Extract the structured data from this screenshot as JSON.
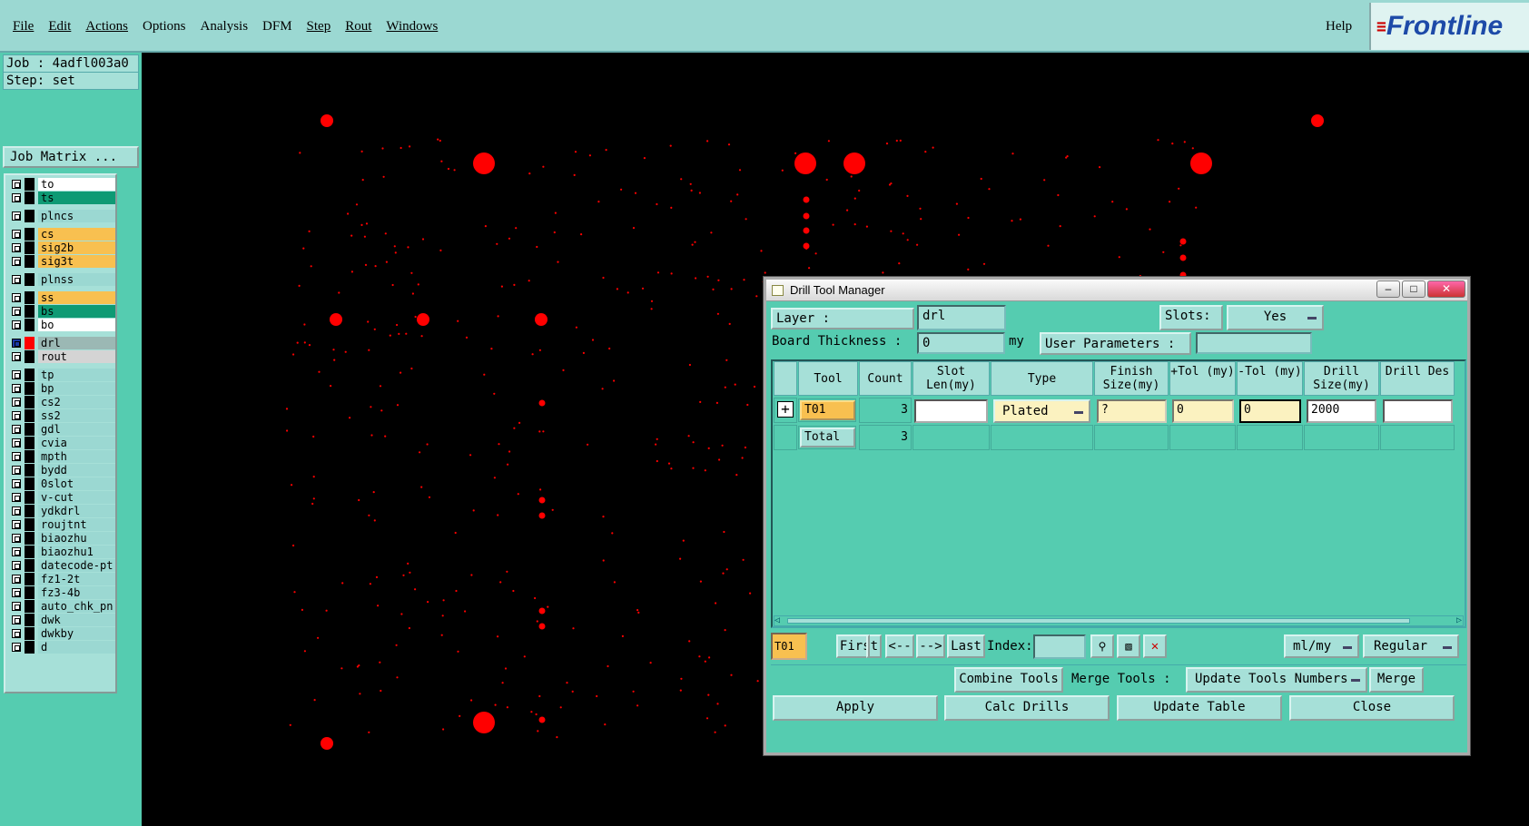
{
  "menubar": {
    "items": [
      "File",
      "Edit",
      "Actions",
      "Options",
      "Analysis",
      "DFM",
      "Step",
      "Rout",
      "Windows"
    ],
    "help": "Help",
    "logo": "Frontline"
  },
  "sidebar": {
    "job": "Job : 4adfl003a0",
    "step": "Step: set",
    "job_matrix": "Job Matrix ...",
    "layers": [
      {
        "name": "to",
        "color": "#ffffff"
      },
      {
        "name": "ts",
        "color": "#0e9a74"
      },
      {
        "name": "plncs",
        "color": "#9bd8d2"
      },
      {
        "name": "cs",
        "color": "#f8c050"
      },
      {
        "name": "sig2b",
        "color": "#f8c050"
      },
      {
        "name": "sig3t",
        "color": "#f8c050"
      },
      {
        "name": "plnss",
        "color": "#9bd8d2"
      },
      {
        "name": "ss",
        "color": "#f8c050"
      },
      {
        "name": "bs",
        "color": "#0e9a74"
      },
      {
        "name": "bo",
        "color": "#ffffff"
      },
      {
        "name": "drl",
        "color": "#9bb8b4"
      },
      {
        "name": "rout",
        "color": "#d4d4d4"
      },
      {
        "name": "tp",
        "color": "#9bd8d2"
      },
      {
        "name": "bp",
        "color": "#9bd8d2"
      },
      {
        "name": "cs2",
        "color": "#9bd8d2"
      },
      {
        "name": "ss2",
        "color": "#9bd8d2"
      },
      {
        "name": "gdl",
        "color": "#9bd8d2"
      },
      {
        "name": "cvia",
        "color": "#9bd8d2"
      },
      {
        "name": "mpth",
        "color": "#9bd8d2"
      },
      {
        "name": "bydd",
        "color": "#9bd8d2"
      },
      {
        "name": "0slot",
        "color": "#9bd8d2"
      },
      {
        "name": "v-cut",
        "color": "#9bd8d2"
      },
      {
        "name": "ydkdrl",
        "color": "#9bd8d2"
      },
      {
        "name": "roujtnt",
        "color": "#9bd8d2"
      },
      {
        "name": "biaozhu",
        "color": "#9bd8d2"
      },
      {
        "name": "biaozhu1",
        "color": "#9bd8d2"
      },
      {
        "name": "datecode-pt",
        "color": "#9bd8d2"
      },
      {
        "name": "fz1-2t",
        "color": "#9bd8d2"
      },
      {
        "name": "fz3-4b",
        "color": "#9bd8d2"
      },
      {
        "name": "auto_chk_pn",
        "color": "#9bd8d2"
      },
      {
        "name": "dwk",
        "color": "#9bd8d2"
      },
      {
        "name": "dwkby",
        "color": "#9bd8d2"
      },
      {
        "name": "d",
        "color": "#9bd8d2"
      }
    ]
  },
  "dialog": {
    "title": "Drill Tool Manager",
    "layer_label": "Layer                :",
    "layer_value": "drl",
    "slots_label": "Slots:",
    "slots_value": "Yes",
    "board_thickness_label": "Board Thickness  :",
    "board_thickness_value": "0",
    "board_thickness_unit": "my",
    "user_params_label": "User Parameters  :",
    "columns": [
      "Tool",
      "Count",
      "Slot Len(my)",
      "Type",
      "Finish Size(my)",
      "+Tol (my)",
      "-Tol (my)",
      "Drill Size(my)",
      "Drill Des"
    ],
    "row": {
      "tool": "T01",
      "count": "3",
      "type": "Plated",
      "finish": "?",
      "ptol": "0",
      "ntol": "0",
      "drill": "2000"
    },
    "total": {
      "label": "Total",
      "count": "3"
    },
    "nav": {
      "current": "T01",
      "first": "First",
      "prev": "<--",
      "next": "-->",
      "last": "Last",
      "index_label": "Index:",
      "units": "ml/my",
      "mode": "Regular"
    },
    "actions": {
      "combine": "Combine Tools",
      "merge_tools": "Merge Tools  :",
      "update_numbers": "Update Tools Numbers",
      "merge": "Merge"
    },
    "bottom": {
      "apply": "Apply",
      "calc": "Calc Drills",
      "update": "Update Table",
      "close": "Close"
    }
  },
  "colors": {
    "pad": "#ff0000",
    "panel": "#55ccb0",
    "light": "#a6e0d8"
  }
}
